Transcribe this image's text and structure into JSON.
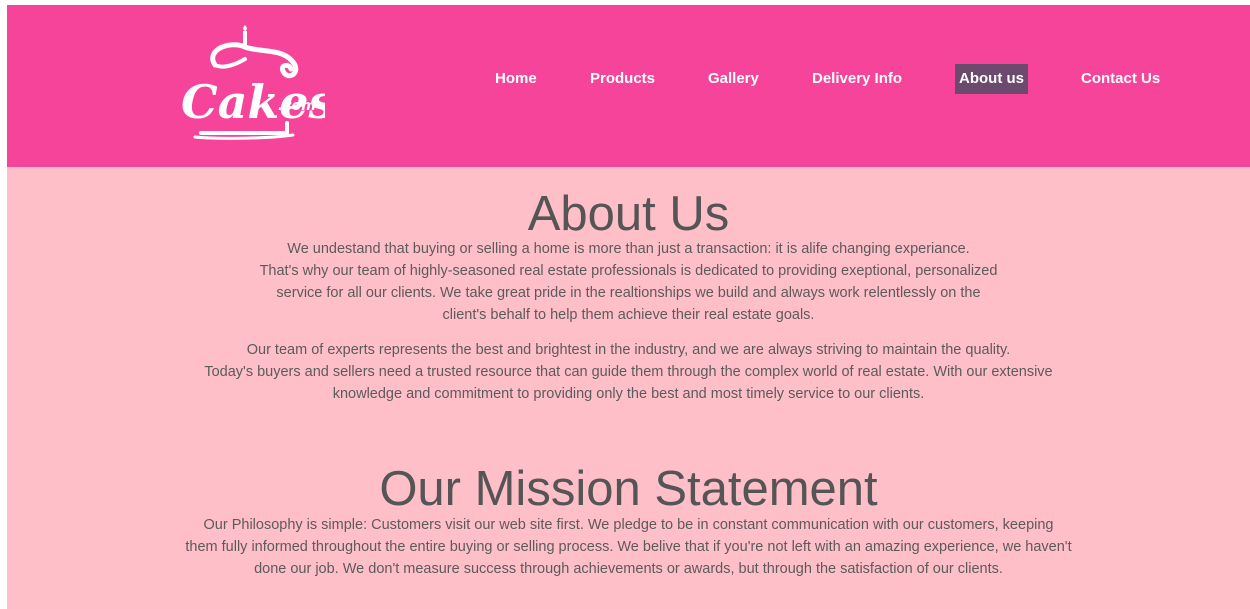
{
  "brand": {
    "logo_word": "Cakes",
    "logo_suffix": ".com"
  },
  "nav": {
    "items": [
      {
        "label": "Home"
      },
      {
        "label": "Products"
      },
      {
        "label": "Gallery"
      },
      {
        "label": "Delivery Info"
      },
      {
        "label": "About us",
        "active": true
      },
      {
        "label": "Contact Us"
      }
    ]
  },
  "about": {
    "title": "About Us",
    "paragraph1": [
      "We undestand that buying or selling a home is more than just a transaction: it is alife changing experiance.",
      "That's why our team of highly-seasoned real estate professionals is dedicated to providing exeptional, personalized",
      "service for all our clients. We take great pride in the realtionships we build and always work relentlessly on the",
      "client's behalf to help them achieve their real estate goals."
    ],
    "paragraph2": [
      "Our team of experts represents the best and brightest in the industry, and we are always striving to maintain the quality.",
      "Today's buyers and sellers need a trusted resource that can guide them through the complex world of real estate. With our extensive",
      "knowledge and commitment to providing only the best and most timely service to our clients."
    ]
  },
  "mission": {
    "title": "Our Mission Statement",
    "paragraph": [
      "Our Philosophy is simple: Customers visit our web site first. We pledge to be in constant communication with our customers, keeping",
      "them fully informed throughout the entire buying or selling process. We belive that if you're not left with an amazing experience, we haven't",
      "done our job. We don't measure success through achievements or awards, but through the satisfaction of our clients."
    ]
  },
  "colors": {
    "header_bg": "#f5449a",
    "page_bg": "#ffbfc9",
    "active_nav_bg": "#6b4a6e",
    "text": "#5b5b5b"
  }
}
